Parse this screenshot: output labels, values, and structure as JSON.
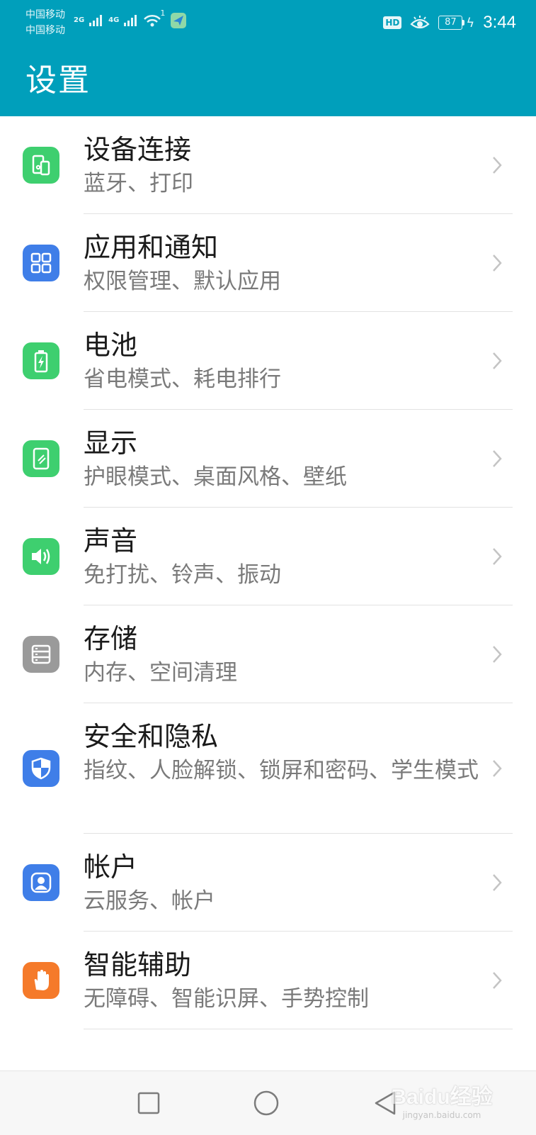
{
  "status_bar": {
    "carrier_1": "中国移动",
    "carrier_2": "中国移动",
    "net_2g": "2G",
    "net_4g": "4G",
    "wifi_count": "1",
    "hd": "HD",
    "battery": "87",
    "time": "3:44"
  },
  "page": {
    "title": "设置"
  },
  "colors": {
    "header": "#009fbb",
    "green": "#3ecf6f",
    "blue": "#3f7ee8",
    "gray": "#9a9a9a",
    "orange": "#f57a2a"
  },
  "items": [
    {
      "title": "设备连接",
      "subtitle": "蓝牙、打印",
      "icon": "device-connection-icon"
    },
    {
      "title": "应用和通知",
      "subtitle": "权限管理、默认应用",
      "icon": "apps-grid-icon"
    },
    {
      "title": "电池",
      "subtitle": "省电模式、耗电排行",
      "icon": "battery-icon"
    },
    {
      "title": "显示",
      "subtitle": "护眼模式、桌面风格、壁纸",
      "icon": "display-icon"
    },
    {
      "title": "声音",
      "subtitle": "免打扰、铃声、振动",
      "icon": "speaker-icon"
    },
    {
      "title": "存储",
      "subtitle": "内存、空间清理",
      "icon": "storage-icon"
    },
    {
      "title": "安全和隐私",
      "subtitle": "指纹、人脸解锁、锁屏和密码、学生模式",
      "icon": "shield-icon"
    },
    {
      "title": "帐户",
      "subtitle": "云服务、帐户",
      "icon": "account-icon"
    },
    {
      "title": "智能辅助",
      "subtitle": "无障碍、智能识屏、手势控制",
      "icon": "hand-icon"
    }
  ],
  "watermark": {
    "brand": "Baidu经验",
    "url": "jingyan.baidu.com"
  }
}
